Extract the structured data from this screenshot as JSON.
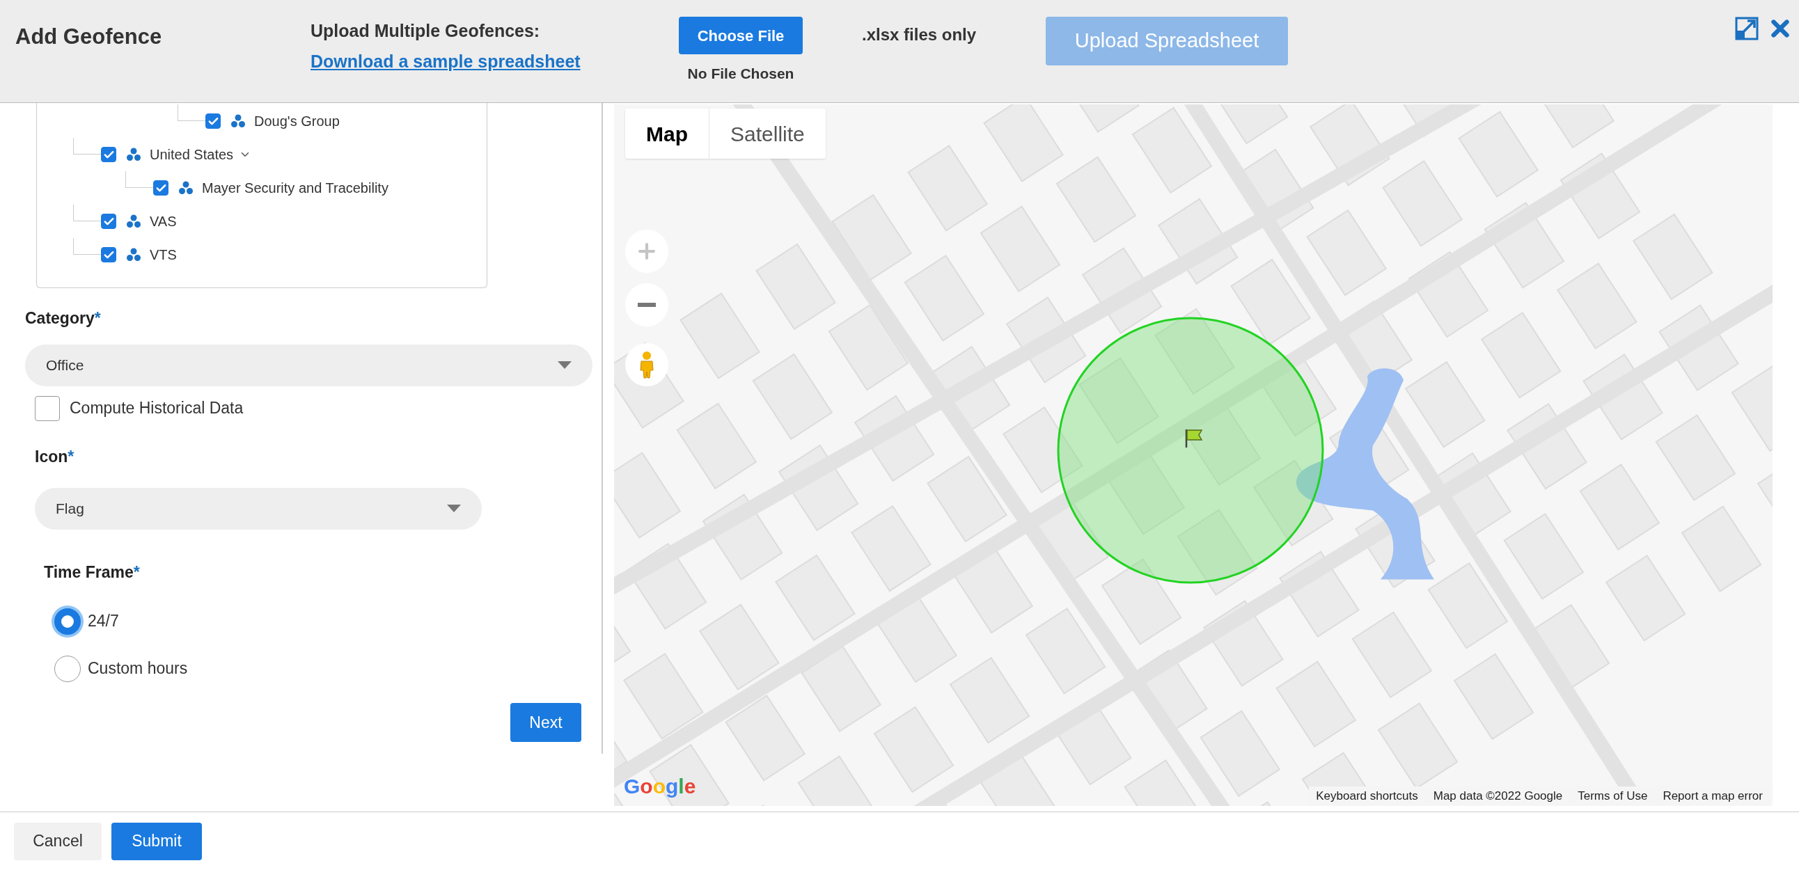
{
  "header": {
    "title": "Add Geofence",
    "upload_label": "Upload Multiple Geofences:",
    "sample_link": "Download a sample spreadsheet",
    "choose_button": "Choose File",
    "file_status": "No File Chosen",
    "file_hint": ".xlsx files only",
    "upload_button": {
      "label": "Upload Spreadsheet",
      "disabled": true
    }
  },
  "tree": [
    {
      "children": [
        {
          "label": "Doug's Group",
          "checked": true
        }
      ]
    },
    {
      "label": "United States",
      "checked": true,
      "expanded": true,
      "children": [
        {
          "label": "Mayer Security and Tracebility",
          "checked": true
        }
      ]
    },
    {
      "label": "VAS",
      "checked": true
    },
    {
      "label": "VTS",
      "checked": true
    }
  ],
  "category": {
    "label": "Category",
    "required": "*",
    "value": "Office"
  },
  "historical": {
    "label": "Compute Historical Data",
    "checked": false
  },
  "icon_select": {
    "label": "Icon",
    "required": "*",
    "value": "Flag"
  },
  "time_frame": {
    "label": "Time Frame",
    "required": "*",
    "options": [
      {
        "label": "24/7",
        "selected": true
      },
      {
        "label": "Custom hours",
        "selected": false
      }
    ]
  },
  "next_button": "Next",
  "map": {
    "types": [
      {
        "label": "Map",
        "selected": true
      },
      {
        "label": "Satellite",
        "selected": false
      }
    ],
    "logo": "Google",
    "footer_links": [
      "Keyboard shortcuts",
      "Map data ©2022 Google",
      "Terms of Use",
      "Report a map error"
    ]
  },
  "footer": {
    "cancel": "Cancel",
    "submit": "Submit"
  }
}
